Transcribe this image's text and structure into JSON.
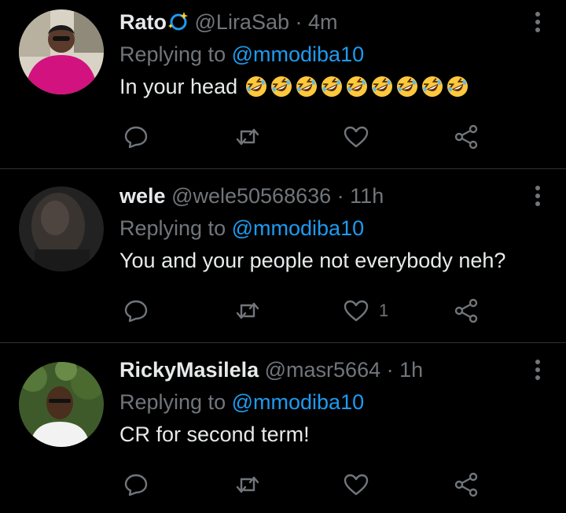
{
  "tweets": [
    {
      "name": "Rato",
      "handle": "@LiraSab",
      "separator": "·",
      "time": "4m",
      "replying_prefix": "Replying to",
      "replying_to": "@mmodiba10",
      "text": "In your head",
      "emoji_count": 9,
      "emoji_name": "rolling-on-floor-laughing",
      "like_count": ""
    },
    {
      "name": "wele",
      "handle": "@wele50568636",
      "separator": "·",
      "time": "11h",
      "replying_prefix": "Replying to",
      "replying_to": "@mmodiba10",
      "text": "You and your people not everybody neh?",
      "like_count": "1"
    },
    {
      "name": "RickyMasilela",
      "handle": "@masr5664",
      "separator": "·",
      "time": "1h",
      "replying_prefix": "Replying to",
      "replying_to": "@mmodiba10",
      "text": "CR for second term!",
      "like_count": ""
    }
  ],
  "colors": {
    "background": "#000000",
    "text": "#e7e9ea",
    "muted": "#71767b",
    "link": "#1d9bf0",
    "divider": "#2f3336"
  }
}
